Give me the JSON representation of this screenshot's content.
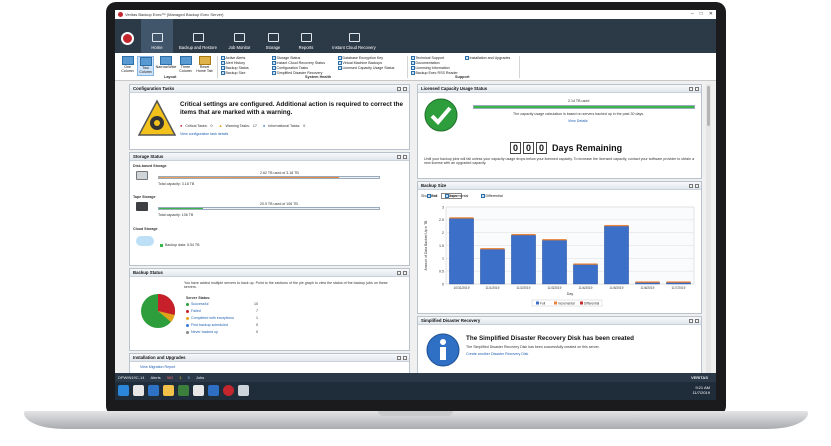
{
  "window": {
    "title": "Veritas Backup Exec™ (Managed Backup Exec Server)",
    "controls": [
      "–",
      "□",
      "✕"
    ]
  },
  "ribbon_tabs": [
    {
      "label": "Home",
      "icon": "home-icon",
      "active": true
    },
    {
      "label": "Backup and Restore",
      "icon": "backup-restore-icon",
      "active": false
    },
    {
      "label": "Job Monitor",
      "icon": "job-monitor-icon",
      "active": false
    },
    {
      "label": "Storage",
      "icon": "storage-icon",
      "active": false
    },
    {
      "label": "Reports",
      "icon": "reports-icon",
      "active": false
    },
    {
      "label": "Instant Cloud Recovery",
      "icon": "cloud-recovery-icon",
      "active": false
    }
  ],
  "layout_group": {
    "label": "Layout",
    "buttons": [
      "One Column",
      "Two Column",
      "Narrow/Wide",
      "Three Column",
      "Reset Home Tab"
    ]
  },
  "system_health": {
    "label": "System Health",
    "col1": [
      "Active Alerts",
      "Alert History",
      "Backup Status",
      "Backup Size"
    ],
    "col2": [
      "Storage Status",
      "Instant Cloud Recovery Status",
      "Configuration Tasks",
      "Simplified Disaster Recovery"
    ],
    "col3": [
      "Database Encryption Key",
      "Virtual Machine Backups",
      "Licensed Capacity Usage Status"
    ]
  },
  "support": {
    "label": "Support",
    "col1": [
      "Technical Support",
      "Documentation",
      "Licensing Information",
      "Backup Exec RSS Reader"
    ],
    "col2": [
      "Installation and Upgrades"
    ]
  },
  "config_tasks": {
    "title": "Configuration Tasks",
    "heading": "Critical settings are configured. Additional action is required to correct the items that are marked with a warning.",
    "critical_label": "Critical Tasks:",
    "critical_count": "0",
    "warning_label": "Warning Tasks:",
    "warning_count": "17",
    "info_label": "Informational Tasks:",
    "info_count": "0",
    "link": "View configuration task details"
  },
  "storage_status": {
    "title": "Storage Status",
    "disk_label": "Disk-based Storage",
    "disk_used": "2.62 TB used of 3.18 TB",
    "disk_fill": 0.82,
    "disk_total": "Total capacity: 3.18 TB",
    "tape_label": "Tape Storage",
    "tape_used": "20.9 TB used of 106 TB",
    "tape_fill": 0.2,
    "tape_total": "Total capacity: 106 TB",
    "cloud_label": "Cloud Storage",
    "cloud_data": "Backup data: 5.54 TB"
  },
  "backup_status": {
    "title": "Backup Status",
    "intro": "You have added multiple servers to back up. Point to the sections of the pie graph to view the status of the backup jobs on these servers.",
    "server_status": "Server Status:",
    "rows": [
      {
        "label": "Successful",
        "value": "10",
        "color": "#2e9e3c"
      },
      {
        "label": "Failed",
        "value": "7",
        "color": "#c8202a"
      },
      {
        "label": "Completed with exceptions",
        "value": "1",
        "color": "#e3a21a"
      },
      {
        "label": "First backup scheduled",
        "value": "0",
        "color": "#3a7bd5"
      },
      {
        "label": "Never backed up",
        "value": "0",
        "color": "#888888"
      }
    ]
  },
  "install_upgrades": {
    "title": "Installation and Upgrades",
    "link": "View Migration Report"
  },
  "license": {
    "title": "Licensed Capacity Usage Status",
    "used": "2.14 TB used",
    "note": "The capacity usage calculation is based on servers backed up in the past 30 days.",
    "link": "View Details",
    "digits": [
      "0",
      "0",
      "0"
    ],
    "days_label": "Days Remaining",
    "message": "Until your backup jobs will fail unless your capacity usage drops below your licensed capacity. To increase the licensed capacity, contact your software provider to obtain a new license with an upgraded capacity."
  },
  "backup_size": {
    "title": "Backup Size",
    "show_last_label": "Show last:",
    "show_last_value": "7 Days",
    "filters": [
      "Full",
      "Incremental",
      "Differential"
    ],
    "ylabel": "Amount of Data Backed Up in TB",
    "xlabel": "Day",
    "legend": [
      "Full",
      "Incremental",
      "Differential"
    ]
  },
  "chart_data": {
    "type": "bar",
    "categories": [
      "10/31/2019",
      "11/1/2019",
      "11/2/2019",
      "11/3/2019",
      "11/4/2019",
      "11/5/2019",
      "11/6/2019",
      "11/7/2019"
    ],
    "series": [
      {
        "name": "Full",
        "values": [
          2.55,
          1.35,
          1.9,
          1.7,
          0.75,
          2.25,
          0.05,
          0.05
        ]
      },
      {
        "name": "Incremental",
        "values": [
          0.05,
          0.05,
          0.05,
          0.05,
          0.05,
          0.05,
          0.05,
          0.05
        ]
      },
      {
        "name": "Differential",
        "values": [
          0,
          0,
          0,
          0,
          0,
          0,
          0,
          0
        ]
      }
    ],
    "yticks": [
      "0",
      "0.5",
      "1",
      "1.5",
      "2",
      "2.5",
      "3"
    ],
    "ylim": [
      0,
      3
    ],
    "colors": {
      "Full": "#3c6fc8",
      "Incremental": "#e8833a",
      "Differential": "#c22d2d"
    },
    "xlabel": "Day",
    "ylabel": "Amount of Data Backed Up in TB",
    "legend_position": "bottom"
  },
  "sdr": {
    "title": "Simplified Disaster Recovery",
    "heading": "The Simplified Disaster Recovery Disk has been created",
    "text": "The Simplified Disaster Recovery Disk has been successfully created on this server.",
    "link": "Create another Disaster Recovery Disk"
  },
  "statusbar": {
    "server": "DPWIN19C-14",
    "alerts": "Alerts",
    "a1": "962",
    "a2": "1",
    "a3": "5",
    "jobs": "Jobs",
    "right": "VERITAS"
  },
  "taskbar": {
    "time": "9:21 AM",
    "date": "11/7/2019"
  }
}
